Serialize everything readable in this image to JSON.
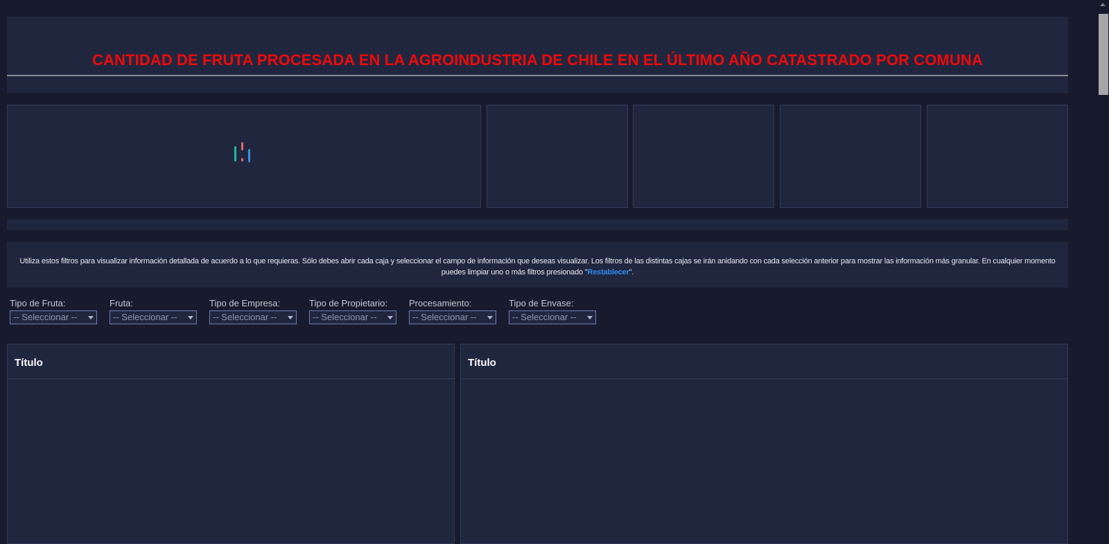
{
  "header": {
    "title": "CANTIDAD DE FRUTA PROCESADA EN LA AGROINDUSTRIA DE CHILE EN EL ÚLTIMO AÑO CATASTRADO POR COMUNA"
  },
  "info": {
    "text": "Utiliza estos filtros para visualizar información detallada de acuerdo a lo que requieras. Sólo debes abrir cada caja y seleccionar el campo de información que deseas visualizar. Los filtros de las distintas cajas se irán anidando con cada selección anterior para mostrar las información más granular. En cualquier momento puedes limpiar uno o más filtros presionado \"",
    "link": "Restablecer",
    "text_end": "\"."
  },
  "filters": [
    {
      "label": "Tipo de Fruta:",
      "value": "-- Seleccionar --"
    },
    {
      "label": "Fruta:",
      "value": "-- Seleccionar --"
    },
    {
      "label": "Tipo de Empresa:",
      "value": "-- Seleccionar --"
    },
    {
      "label": "Tipo de Propietario:",
      "value": "-- Seleccionar --"
    },
    {
      "label": "Procesamiento:",
      "value": "-- Seleccionar --"
    },
    {
      "label": "Tipo de Envase:",
      "value": "-- Seleccionar --"
    }
  ],
  "cards": [
    {
      "title": "Título"
    },
    {
      "title": "Título"
    }
  ],
  "icons": {
    "loader": "loading-spinner-icon",
    "dropdown": "chevron-down-icon"
  },
  "colors": {
    "background": "#181b2e",
    "panel": "#21263f",
    "title": "#ee0a0a",
    "link": "#2d8cf0",
    "select_border": "#6e7cb6"
  }
}
